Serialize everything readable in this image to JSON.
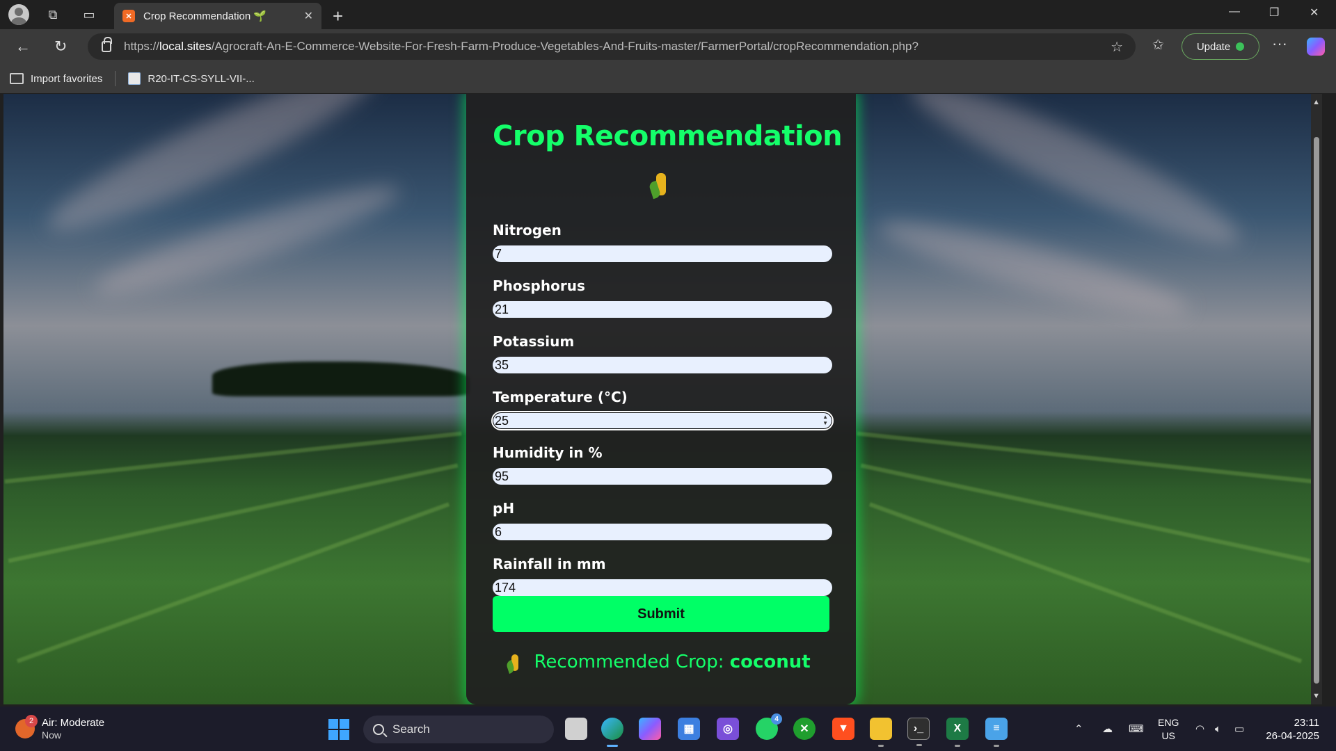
{
  "browser": {
    "tab_title": "Crop Recommendation 🌱",
    "url_prefix": "https://",
    "url_host": "local.sites",
    "url_path": "/Agrocraft-An-E-Commerce-Website-For-Fresh-Farm-Produce-Vegetables-And-Fruits-master/FarmerPortal/cropRecommendation.php?",
    "update_label": "Update",
    "favorites": [
      {
        "label": "Import favorites"
      },
      {
        "label": "R20-IT-CS-SYLL-VII-..."
      }
    ]
  },
  "page": {
    "title": "Crop Recommendation",
    "fields": [
      {
        "label": "Nitrogen",
        "value": "7"
      },
      {
        "label": "Phosphorus",
        "value": "21"
      },
      {
        "label": "Potassium",
        "value": "35"
      },
      {
        "label": "Temperature (°C)",
        "value": "25"
      },
      {
        "label": "Humidity in %",
        "value": "95"
      },
      {
        "label": "pH",
        "value": "6"
      },
      {
        "label": "Rainfall in mm",
        "value": "174"
      }
    ],
    "submit_label": "Submit",
    "result_label": "Recommended Crop:",
    "result_value": "coconut"
  },
  "taskbar": {
    "weather_title": "Air: Moderate",
    "weather_sub": "Now",
    "weather_badge": "2",
    "search_label": "Search",
    "whatsapp_badge": "4",
    "lang_top": "ENG",
    "lang_bottom": "US",
    "time": "23:11",
    "date": "26-04-2025"
  },
  "colors": {
    "accent": "#14ff6a",
    "submit": "#00ff66",
    "card_bg": "#202020",
    "input_bg": "#e8f0fe"
  }
}
